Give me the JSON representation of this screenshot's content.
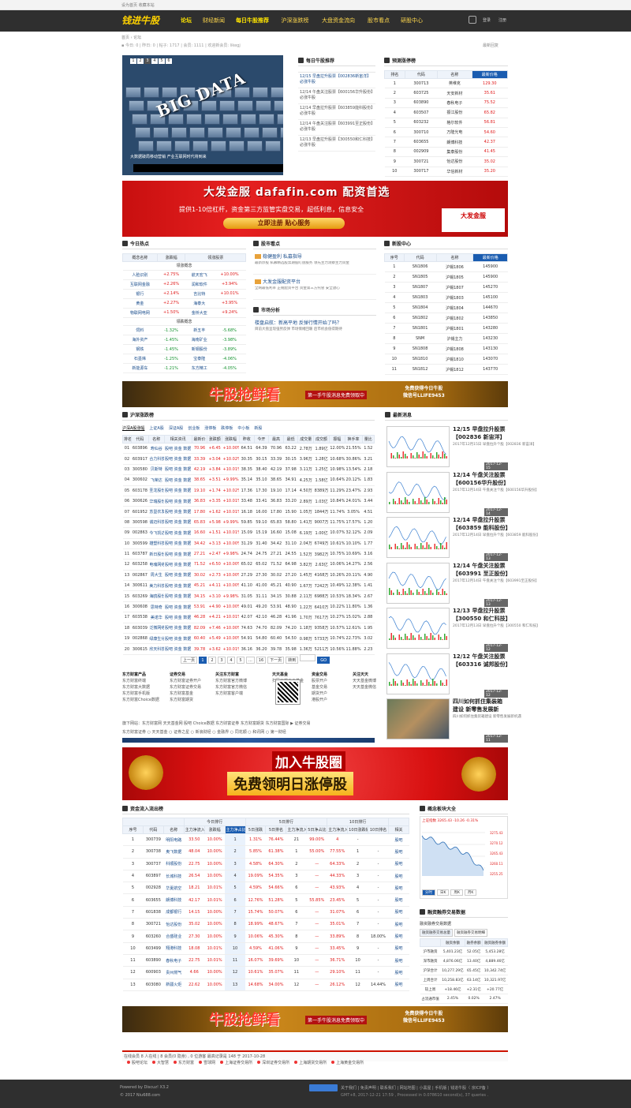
{
  "topbar": {
    "left": "设为首页  收藏本站",
    "right": ""
  },
  "nav": {
    "logo": "钱进牛股",
    "items": [
      "论坛",
      "财经新闻",
      "每日牛股推荐",
      "沪深涨跌榜",
      "大盘资金流向",
      "股市看点",
      "研股中心"
    ],
    "login": "登录",
    "register": "注册",
    "search_icon": "search-icon"
  },
  "crumb": "首页 › 论坛",
  "meta": "▪ 今日: 0 | 昨日: 0 | 帖子: 1717 | 会员: 1111 | 欢迎新会员: likegj",
  "meta_right": "最新回复",
  "slider": {
    "pages": [
      "1",
      "2",
      "3",
      "4",
      "5",
      "6"
    ],
    "active": 2,
    "headline": "BIG DATA",
    "caption": "大数据破局移动营销 产业互联网时代将到来"
  },
  "daily": {
    "title": "每日牛股推荐",
    "items": [
      {
        "text": "12/15 早盘拉升股票【002836新宙洋】必涨牛股",
        "hot": true
      },
      {
        "text": "12/14 午盘关注股票【600156华升股份】必涨牛股",
        "hot": false
      },
      {
        "text": "12/14 早盘拉升股票【603859能科股份】必涨牛股",
        "hot": false
      },
      {
        "text": "12/14 午盘关注股票【603991至正股份】必涨牛股",
        "hot": false
      },
      {
        "text": "12/13 早盘拉升股票【300550和仁科技】必涨牛股",
        "hot": false
      }
    ]
  },
  "forecast": {
    "title": "预测涨停榜",
    "headers": [
      "排名",
      "代码",
      "名称",
      "最新价格"
    ],
    "rows": [
      [
        "1",
        "300713",
        "英维克",
        "129.30"
      ],
      [
        "2",
        "603725",
        "天安新材",
        "35.61"
      ],
      [
        "3",
        "603890",
        "春秋电子",
        "75.52"
      ],
      [
        "4",
        "603507",
        "振江股份",
        "65.82"
      ],
      [
        "5",
        "603232",
        "格尔软件",
        "56.81"
      ],
      [
        "6",
        "300710",
        "万隆光电",
        "54.60"
      ],
      [
        "7",
        "603655",
        "朗博科技",
        "42.37"
      ],
      [
        "8",
        "002909",
        "集泰股份",
        "41.45"
      ],
      [
        "9",
        "300721",
        "怡达股份",
        "35.02"
      ],
      [
        "10",
        "300717",
        "华信新材",
        "35.20"
      ]
    ]
  },
  "banner1": {
    "title": "大发金服 dafafin.com 配资首选",
    "sub": "提供1-10倍杠杆，资金第三方监管实盘交易，超低利息，信息安全",
    "button": "立即注册 贴心服务",
    "logo": "大发金服"
  },
  "hot": {
    "title": "今日热点",
    "headers": [
      "概念名称",
      "涨跌幅",
      "领涨股票"
    ],
    "up_label": "领涨概念",
    "down_label": "领跌概念",
    "up": [
      [
        "人脸识别",
        "+2.75%",
        "航天宏飞",
        "+10.00%"
      ],
      [
        "互联网金融",
        "+2.26%",
        "润和软件",
        "+3.94%"
      ],
      [
        "银行",
        "+2.14%",
        "吉比特",
        "+10.01%"
      ],
      [
        "黄金",
        "+2.27%",
        "海泰大",
        "+3.95%"
      ],
      [
        "物联网电网",
        "+1.50%",
        "金桥大亚",
        "+9.24%"
      ]
    ],
    "down": [
      [
        "饲料",
        "-1.32%",
        "新五丰",
        "-5.68%"
      ],
      [
        "海外资产",
        "-1.45%",
        "海南矿业",
        "-3.98%"
      ],
      [
        "钢铁",
        "-1.45%",
        "新钢股份",
        "-3.89%"
      ],
      [
        "石墨烯",
        "-1.25%",
        "宝泰隆",
        "-4.06%"
      ],
      [
        "新能源车",
        "-1.21%",
        "东方精工",
        "-4.05%"
      ]
    ]
  },
  "stockview": {
    "title": "股市看点",
    "items": [
      {
        "title": "稳健盈利 私募指导",
        "body": "最新炒股 私募精选股票期股盯盘服务 领先主力洞察主力资金"
      },
      {
        "title": "大发金服配资平台",
        "body": "全网最低利率 正规配资平台 资金第三方托管 安全放心"
      }
    ]
  },
  "market": {
    "title": "市场分析",
    "item": {
      "title": "楼盘启航：新高平地 反弹行情开始了吗？",
      "body": "目前大盘呈现强势反弹 市场情绪回暖 后市机会值得期待"
    }
  },
  "newstock": {
    "title": "新股中心",
    "headers": [
      "序号",
      "代码",
      "名称",
      "最新价格"
    ],
    "rows": [
      [
        "1",
        "SN1806",
        "沪锡1806",
        "145900"
      ],
      [
        "2",
        "SN1805",
        "沪锡1805",
        "145900"
      ],
      [
        "3",
        "SN1807",
        "沪锡1807",
        "145270"
      ],
      [
        "4",
        "SN1803",
        "沪锡1803",
        "145100"
      ],
      [
        "5",
        "SN1804",
        "沪锡1804",
        "144670"
      ],
      [
        "6",
        "SN1802",
        "沪锡1802",
        "143850"
      ],
      [
        "7",
        "SN1801",
        "沪锡1801",
        "143280"
      ],
      [
        "8",
        "SNM",
        "沪锡主力",
        "143230"
      ],
      [
        "9",
        "SN1808",
        "沪锡1808",
        "143130"
      ],
      [
        "10",
        "SN1810",
        "沪锡1810",
        "143070"
      ],
      [
        "11",
        "SN1812",
        "沪锡1812",
        "143770"
      ]
    ]
  },
  "banner2": {
    "title": "牛股抢鲜看",
    "sub": "第一手牛股消息免费领取中",
    "right1": "免费获得今日牛股",
    "right2": "微信号LLIFE9453"
  },
  "ranking": {
    "title": "沪深涨跌榜",
    "tabs": [
      "沪深A股涨幅",
      "上证A股",
      "深证A股",
      "创业板",
      "涨停板",
      "跌停板",
      "中小板",
      "新股"
    ],
    "headers": [
      "排名",
      "代码",
      "名称",
      "相关资讯",
      "最新价",
      "涨跌额",
      "涨跌幅",
      "昨收",
      "今开",
      "最高",
      "最低",
      "成交量",
      "成交额",
      "振幅",
      "换手率",
      "量比"
    ],
    "rows": [
      [
        "01",
        "603896",
        "寿仙谷",
        "股吧 资金 数据",
        "70.96",
        "+6.45",
        "+10.00%",
        "64.51",
        "64.39",
        "70.96",
        "63.22",
        "2.78万",
        "1.89亿",
        "12.00%",
        "21.55%",
        "1.52"
      ],
      [
        "02",
        "603917",
        "合力科技",
        "股吧 资金 数据",
        "33.39",
        "+3.04",
        "+10.02%",
        "30.35",
        "30.15",
        "33.39",
        "30.15",
        "3.96万",
        "1.28亿",
        "10.68%",
        "30.86%",
        "3.21"
      ],
      [
        "03",
        "300580",
        "贝斯特",
        "股吧 资金 数据",
        "42.19",
        "+3.84",
        "+10.01%",
        "38.35",
        "38.40",
        "42.19",
        "37.98",
        "3.11万",
        "1.25亿",
        "10.98%",
        "13.54%",
        "2.18"
      ],
      [
        "04",
        "300602",
        "飞荣达",
        "股吧 资金 数据",
        "38.65",
        "+3.51",
        "+9.99%",
        "35.14",
        "35.10",
        "38.65",
        "34.91",
        "4.25万",
        "1.58亿",
        "10.64%",
        "20.12%",
        "1.83"
      ],
      [
        "05",
        "603178",
        "圣龙股份",
        "股吧 资金 数据",
        "19.10",
        "+1.74",
        "+10.02%",
        "17.36",
        "17.30",
        "19.10",
        "17.14",
        "4.50万",
        "8389万",
        "11.29%",
        "23.47%",
        "2.93"
      ],
      [
        "06",
        "300626",
        "华瑞股份",
        "股吧 资金 数据",
        "36.83",
        "+3.35",
        "+10.01%",
        "33.48",
        "33.41",
        "36.83",
        "33.20",
        "2.89万",
        "1.03亿",
        "10.84%",
        "24.01%",
        "3.44"
      ],
      [
        "07",
        "601952",
        "苏垦农发",
        "股吧 资金 数据",
        "17.80",
        "+1.62",
        "+10.01%",
        "16.18",
        "16.00",
        "17.80",
        "15.90",
        "1.05万",
        "1844万",
        "11.74%",
        "3.05%",
        "4.51"
      ],
      [
        "08",
        "300598",
        "诚迈科技",
        "股吧 资金 数据",
        "65.83",
        "+5.98",
        "+9.99%",
        "59.85",
        "59.10",
        "65.83",
        "58.80",
        "1.41万",
        "9007万",
        "11.75%",
        "17.57%",
        "1.20"
      ],
      [
        "09",
        "002863",
        "今飞凯达",
        "股吧 资金 数据",
        "16.60",
        "+1.51",
        "+10.01%",
        "15.09",
        "15.19",
        "16.60",
        "15.08",
        "6.19万",
        "1.00亿",
        "10.07%",
        "32.12%",
        "2.09"
      ],
      [
        "10",
        "300599",
        "雄塑科技",
        "股吧 资金 数据",
        "34.42",
        "+3.13",
        "+10.00%",
        "31.29",
        "31.40",
        "34.42",
        "31.10",
        "2.04万",
        "6749万",
        "10.61%",
        "10.10%",
        "1.77"
      ],
      [
        "11",
        "603787",
        "新日股份",
        "股吧 资金 数据",
        "27.21",
        "+2.47",
        "+9.98%",
        "24.74",
        "24.75",
        "27.21",
        "24.55",
        "1.52万",
        "3982万",
        "10.75%",
        "10.69%",
        "3.16"
      ],
      [
        "12",
        "603258",
        "电魂网络",
        "股吧 资金 数据",
        "71.52",
        "+6.50",
        "+10.00%",
        "65.02",
        "65.02",
        "71.52",
        "64.98",
        "3.82万",
        "2.63亿",
        "10.06%",
        "14.27%",
        "2.56"
      ],
      [
        "13",
        "002867",
        "周大生",
        "股吧 资金 数据",
        "30.02",
        "+2.73",
        "+10.00%",
        "27.29",
        "27.30",
        "30.02",
        "27.20",
        "1.45万",
        "4168万",
        "10.26%",
        "20.11%",
        "4.90"
      ],
      [
        "14",
        "300611",
        "美力科技",
        "股吧 资金 数据",
        "45.21",
        "+4.11",
        "+10.00%",
        "41.10",
        "41.00",
        "45.21",
        "40.90",
        "1.67万",
        "7242万",
        "10.49%",
        "12.38%",
        "1.41"
      ],
      [
        "15",
        "603269",
        "海鸥股份",
        "股吧 资金 数据",
        "34.15",
        "+3.10",
        "+9.98%",
        "31.05",
        "31.11",
        "34.15",
        "30.88",
        "2.11万",
        "6988万",
        "10.53%",
        "18.34%",
        "2.67"
      ],
      [
        "16",
        "300608",
        "思特奇",
        "股吧 资金 数据",
        "53.91",
        "+4.90",
        "+10.00%",
        "49.01",
        "49.20",
        "53.91",
        "48.90",
        "1.22万",
        "6410万",
        "10.22%",
        "11.80%",
        "1.36"
      ],
      [
        "17",
        "603538",
        "美诺华",
        "股吧 资金 数据",
        "46.28",
        "+4.21",
        "+10.01%",
        "42.07",
        "42.10",
        "46.28",
        "41.96",
        "1.70万",
        "7617万",
        "10.27%",
        "15.02%",
        "2.88"
      ],
      [
        "18",
        "603039",
        "泛微网络",
        "股吧 资金 数据",
        "82.09",
        "+7.46",
        "+10.00%",
        "74.63",
        "74.70",
        "82.09",
        "74.20",
        "1.18万",
        "9358万",
        "10.57%",
        "12.61%",
        "1.95"
      ],
      [
        "19",
        "002868",
        "绿康生化",
        "股吧 资金 数据",
        "60.40",
        "+5.49",
        "+10.00%",
        "54.91",
        "54.80",
        "60.40",
        "54.50",
        "0.98万",
        "5733万",
        "10.74%",
        "22.73%",
        "3.02"
      ],
      [
        "20",
        "300615",
        "欣天科技",
        "股吧 资金 数据",
        "39.78",
        "+3.62",
        "+10.01%",
        "36.16",
        "36.20",
        "39.78",
        "35.98",
        "1.36万",
        "5211万",
        "10.56%",
        "11.88%",
        "2.23"
      ]
    ],
    "pager": {
      "prev": "上一页",
      "pages": [
        "1",
        "2",
        "3",
        "4",
        "5"
      ],
      "ellipsis": "...",
      "last": "16",
      "next": "下一页",
      "goto": "转到",
      "go": "GO"
    }
  },
  "latest": {
    "title": "最新消息",
    "items": [
      {
        "title": "12/15 早盘拉升股票",
        "title2": "【002836 新宙洋】",
        "desc": "2017年12月15日 早盘拉升个股【002836 新宙洋】",
        "date": "2017-12-15"
      },
      {
        "title": "12/14 午盘关注股票",
        "title2": "【600156华升股份】",
        "desc": "2017年12月14日 午盘关注个股【600156华升股份】",
        "date": "2017-12-14"
      },
      {
        "title": "12/14 早盘拉升股票",
        "title2": "【603859 能科股份】",
        "desc": "2017年12月14日 早盘拉升个股【603859 能科股份】",
        "date": "2017-12-13"
      },
      {
        "title": "12/14 午盘关注股票",
        "title2": "【603991 至正股份】",
        "desc": "2017年12月14日 午盘关注个股【603991至正股份】",
        "date": "2017-12-13"
      },
      {
        "title": "12/13 早盘拉升股票",
        "title2": "【300550 和仁科技】",
        "desc": "2017年12月13日 早盘拉升个股【300550 和仁科技】",
        "date": "2017-12-12"
      },
      {
        "title": "12/12 午盘关注股票",
        "title2": "【603316 诚邦股份】",
        "desc": "",
        "date": "2017-12-12"
      },
      {
        "title": "四川如何抓住集装箱",
        "title2": "建设 新零售发展新",
        "desc": "四川如何抓住集装箱建设 新零售发展新机遇",
        "date": "2017-12-11"
      }
    ]
  },
  "footlinks": {
    "cols": [
      {
        "title": "东方财富产品",
        "items": [
          "东方财富终端",
          "东方财富大数据",
          "东方财富手机版",
          "东方财富Choice数据"
        ]
      },
      {
        "title": "证券交易",
        "items": [
          "东方财富证券开户",
          "东方财富证券交易",
          "东方财富基金",
          "东方财富期货"
        ]
      },
      {
        "title": "关注东方财富",
        "items": [
          "东方财富官方微博",
          "东方财富官方微信",
          "东方财富客户端"
        ]
      },
      {
        "title": "天天基金",
        "items": [
          "扫码下载天天基金"
        ]
      },
      {
        "title": "资金交易",
        "items": [
          "股票开户",
          "基金交易",
          "期货开户",
          "港股开户"
        ]
      },
      {
        "title": "关注天天",
        "items": [
          "天天基金微博",
          "天天基金微信"
        ]
      }
    ],
    "row1": "旗下网站：东方财富网  天天基金网  股吧  Choice数据  东方财富证券  东方财富期货  东方财富国际  ▶ 证券交易",
    "row2": "东方财富证券 ○ 天天基金 ○ 证券之星 ○ 新浪财经 ○ 金融界 ○ 同花顺 ○ 和讯网 ○ 第一财经"
  },
  "banner3": {
    "line1": "加入牛股圈",
    "line2": "免费领明日涨停股"
  },
  "fundflow": {
    "title": "资金流入流出榜",
    "groups": [
      "今日排行",
      "5日排行",
      "10日排行"
    ],
    "headers": [
      "序号",
      "代码",
      "名称",
      "主力净流入",
      "涨跌幅",
      "主力净占比",
      "5日涨跌",
      "5日排名",
      "主力净流入",
      "5日净占比",
      "主力净流入",
      "10日涨跌幅",
      "10日排名",
      "相关"
    ],
    "rows": [
      [
        "1",
        "300739",
        "明阳电路",
        "33.50",
        "10.00%",
        "1",
        "1.31%",
        "76.44%",
        "21",
        "99.00%",
        "4",
        "-",
        "",
        "股吧"
      ],
      [
        "2",
        "300738",
        "奥飞数据",
        "48.04",
        "10.00%",
        "2",
        "5.85%",
        "61.38%",
        "1",
        "55.00%",
        "77.55%",
        "1",
        "-",
        "股吧"
      ],
      [
        "3",
        "300737",
        "科顺股份",
        "22.75",
        "10.00%",
        "3",
        "4.58%",
        "64.30%",
        "2",
        "—",
        "64.33%",
        "2",
        "-",
        "股吧"
      ],
      [
        "4",
        "603897",
        "长城科技",
        "26.54",
        "10.00%",
        "4",
        "19.09%",
        "54.35%",
        "3",
        "—",
        "44.33%",
        "3",
        "-",
        "股吧"
      ],
      [
        "5",
        "002928",
        "华夏航空",
        "18.21",
        "10.01%",
        "5",
        "4.59%",
        "54.66%",
        "6",
        "—",
        "43.93%",
        "4",
        "-",
        "股吧"
      ],
      [
        "6",
        "603655",
        "朗博科技",
        "42.17",
        "10.01%",
        "6",
        "12.76%",
        "51.28%",
        "5",
        "55.85%",
        "23.45%",
        "5",
        "-",
        "股吧"
      ],
      [
        "7",
        "601838",
        "成都银行",
        "14.15",
        "10.00%",
        "7",
        "15.74%",
        "50.07%",
        "6",
        "—",
        "31.07%",
        "6",
        "-",
        "股吧"
      ],
      [
        "8",
        "300721",
        "怡达股份",
        "35.02",
        "10.00%",
        "8",
        "18.99%",
        "48.67%",
        "7",
        "—",
        "35.01%",
        "7",
        "-",
        "股吧"
      ],
      [
        "9",
        "603260",
        "合盛硅业",
        "27.30",
        "10.00%",
        "9",
        "10.06%",
        "45.30%",
        "8",
        "—",
        "33.89%",
        "8",
        "18.00%",
        "股吧"
      ],
      [
        "10",
        "603499",
        "翔港科技",
        "18.08",
        "10.01%",
        "10",
        "4.59%",
        "41.06%",
        "9",
        "—",
        "33.45%",
        "9",
        "-",
        "股吧"
      ],
      [
        "11",
        "603890",
        "春秋电子",
        "22.75",
        "10.01%",
        "11",
        "16.07%",
        "39.69%",
        "10",
        "—",
        "36.71%",
        "10",
        "-",
        "股吧"
      ],
      [
        "12",
        "600903",
        "贵州燃气",
        "4.66",
        "10.00%",
        "12",
        "10.61%",
        "35.07%",
        "11",
        "—",
        "29.10%",
        "11",
        "-",
        "股吧"
      ],
      [
        "13",
        "603080",
        "新疆火炬",
        "22.62",
        "10.00%",
        "13",
        "14.68%",
        "34.00%",
        "12",
        "—",
        "26.12%",
        "12",
        "14.44%",
        "股吧"
      ]
    ]
  },
  "concept": {
    "title": "概念板块大全",
    "index_label": "上证指数 3265.43 -10.26 -0.31%",
    "buttons": [
      "分时",
      "日K",
      "周K",
      "月K"
    ],
    "ylabels": [
      "3275.43",
      "3270.12",
      "3265.43",
      "3260.11",
      "3255.25"
    ]
  },
  "margin": {
    "title": "融资融券交易数据",
    "subtitle": "融资融券交易数据",
    "tabs": [
      "融资融券交易总量",
      "融资融券交易明细"
    ],
    "headers": [
      "",
      "融资余额",
      "融券余额",
      "融资融券余额"
    ],
    "rows": [
      [
        "沪市融资",
        "5,401.23亿",
        "52.05亿",
        "5,453.28亿"
      ],
      [
        "深市融资",
        "4,876.06亿",
        "13.40亿",
        "4,889.46亿"
      ],
      [
        "沪深合计",
        "10,277.29亿",
        "65.45亿",
        "10,342.74亿"
      ],
      [
        "上周合计",
        "10,258.83亿",
        "63.14亿",
        "10,321.97亿"
      ],
      [
        "较上周",
        "+18.46亿",
        "+2.31亿",
        "+20.77亿"
      ],
      [
        "占流通市值",
        "2.45%",
        "0.02%",
        "2.47%"
      ]
    ]
  },
  "onlinebar": "在线会员  8 人在线  | 8 会员(0 隐身) , 0 位游客   最高记录是 148 于 2017-10-28",
  "botlinks": [
    "股吧论坛",
    "大智慧",
    "东方财富",
    "雪球网",
    "上海证券交易所",
    "深圳证券交易所",
    "上海期货交易所",
    "上海黄金交易所"
  ],
  "footer": {
    "left1": "Powered by Discuz! X3.2",
    "left2": "© 2017 Niu688.com",
    "right1": "关于我们 | 免责声明 | 联系我们 | 网站地图 | 小黑屋 | 手机版 | 钱进牛股（ 京ICP备 ）",
    "right2": "GMT+8, 2017-12-21 17:59 , Processed in 0.078610 second(s), 37 queries ."
  }
}
